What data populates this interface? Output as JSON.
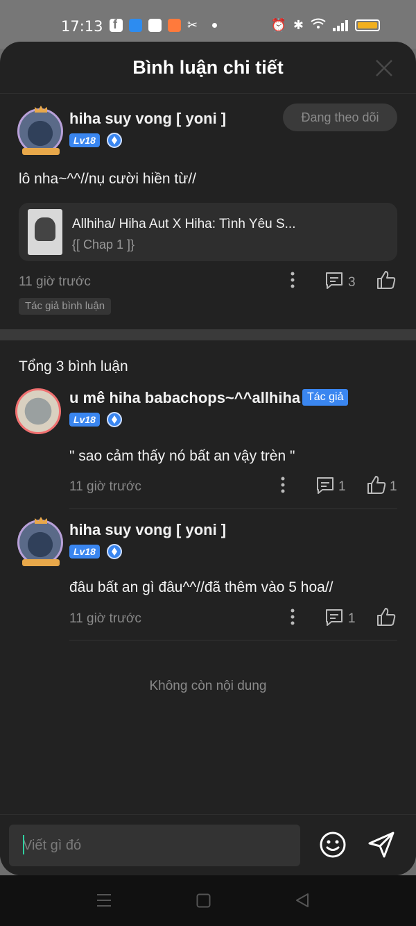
{
  "status_bar": {
    "time": "17:13",
    "app_icons": [
      "facebook-icon",
      "app-blue-icon",
      "app-star-icon",
      "app-game-icon",
      "capcut-icon"
    ],
    "battery_color": "#f2b01e"
  },
  "sheet": {
    "title": "Bình luận chi tiết"
  },
  "main_comment": {
    "username": "hiha suy vong [ yoni ]",
    "level": "Lv18",
    "follow_label": "Đang theo dõi",
    "text": "lô nha~^^//nụ cười hiền từ//",
    "chapter_title": "Allhiha/ Hiha Aut X Hiha: Tình Yêu S...",
    "chapter_sub": "{[ Chap 1 ]}",
    "time": "11 giờ trước",
    "reply_count": "3",
    "author_tag": "Tác giả bình luận"
  },
  "replies": {
    "total_label": "Tổng 3 bình luận",
    "items": [
      {
        "username": "u mê hiha babachops~^^allhiha",
        "author_badge": "Tác giả",
        "level": "Lv18",
        "text": "\" sao cảm thấy nó bất an vậy trèn \"",
        "time": "11 giờ trước",
        "reply_count": "1",
        "like_count": "1"
      },
      {
        "username": "hiha suy vong [ yoni ]",
        "level": "Lv18",
        "text": "đâu bất an gì đâu^^//đã thêm vào 5 hoa//",
        "time": "11 giờ trước",
        "reply_count": "1"
      }
    ],
    "end_note": "Không còn nội dung"
  },
  "composer": {
    "placeholder": "Viết gì đó"
  },
  "colors": {
    "accent": "#3a86f0",
    "sheet_bg": "#222222"
  }
}
